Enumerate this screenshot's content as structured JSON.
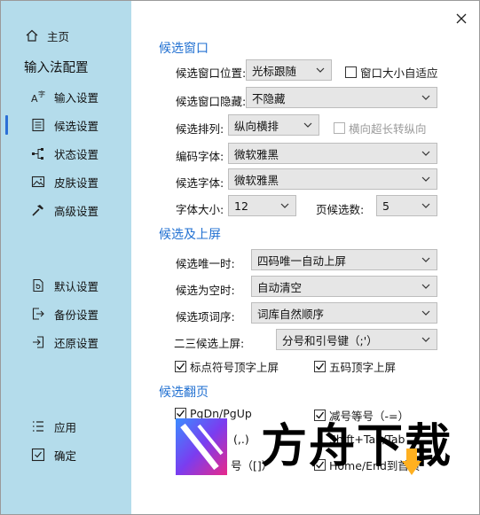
{
  "sidebar": {
    "home_label": "主页",
    "heading": "输入法配置",
    "items": [
      {
        "label": "输入设置",
        "icon": "font-size-icon"
      },
      {
        "label": "候选设置",
        "icon": "list-document-icon"
      },
      {
        "label": "状态设置",
        "icon": "status-nodes-icon"
      },
      {
        "label": "皮肤设置",
        "icon": "image-icon"
      },
      {
        "label": "高级设置",
        "icon": "hammer-icon"
      }
    ],
    "actions": [
      {
        "label": "默认设置",
        "icon": "reset-document-icon"
      },
      {
        "label": "备份设置",
        "icon": "export-icon"
      },
      {
        "label": "还原设置",
        "icon": "import-icon"
      }
    ],
    "footer": [
      {
        "label": "应用",
        "icon": "apply-list-icon"
      },
      {
        "label": "确定",
        "icon": "confirm-check-icon"
      }
    ],
    "active_color": "#2b6fd6",
    "background": "#b4dceb"
  },
  "candidate_window": {
    "title": "候选窗口",
    "position_label": "候选窗口位置:",
    "position_value": "光标跟随",
    "auto_fit_label": "窗口大小自适应",
    "auto_fit_checked": false,
    "hide_label": "候选窗口隐藏:",
    "hide_value": "不隐藏",
    "layout_label": "候选排列:",
    "layout_value": "纵向横排",
    "overflow_label": "横向超长转纵向",
    "overflow_checked": false,
    "code_font_label": "编码字体:",
    "code_font_value": "微软雅黑",
    "cand_font_label": "候选字体:",
    "cand_font_value": "微软雅黑",
    "font_size_label": "字体大小:",
    "font_size_value": "12",
    "page_count_label": "页候选数:",
    "page_count_value": "5"
  },
  "candidate_commit": {
    "title": "候选及上屏",
    "unique_label": "候选唯一时:",
    "unique_value": "四码唯一自动上屏",
    "empty_label": "候选为空时:",
    "empty_value": "自动清空",
    "order_label": "候选项词序:",
    "order_value": "词库自然顺序",
    "second_third_label": "二三候选上屏:",
    "second_third_value": "分号和引号键（;'）",
    "punct_label": "标点符号顶字上屏",
    "punct_checked": true,
    "fivecode_label": "五码顶字上屏",
    "fivecode_checked": true
  },
  "candidate_paging": {
    "title": "候选翻页",
    "pgdn_label": "PgDn/PgUp",
    "pgdn_checked": true,
    "minus_label": "减号等号（-=）",
    "minus_checked": true,
    "comma_label": "(,.)",
    "shift_tab_label": "Shift+Tab/Tab",
    "bracket_label": "号（[]）",
    "home_end_label": "Home/End到首页"
  },
  "watermark_text": "方舟下载",
  "accent_color": "#1f6fd1"
}
